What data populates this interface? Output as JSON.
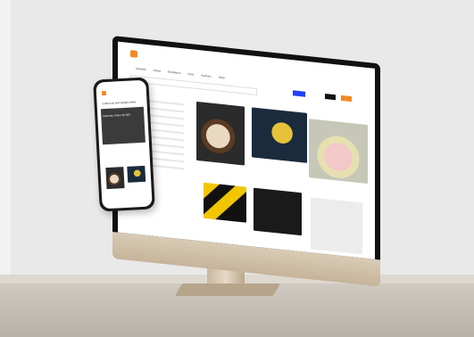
{
  "desktop": {
    "nav": [
      "Artworks",
      "Artists",
      "Exhibitions",
      "Fairs",
      "Auctions",
      "Shop"
    ],
    "buttons": {
      "sign_in": "",
      "log_in": "",
      "join": ""
    },
    "captions": [
      "",
      "",
      ""
    ]
  },
  "phone": {
    "title": "Collect art and design online",
    "hero_text": "Artworks Under $1,000"
  },
  "colors": {
    "accent": "#f08a24",
    "primary": "#1e40ff"
  }
}
